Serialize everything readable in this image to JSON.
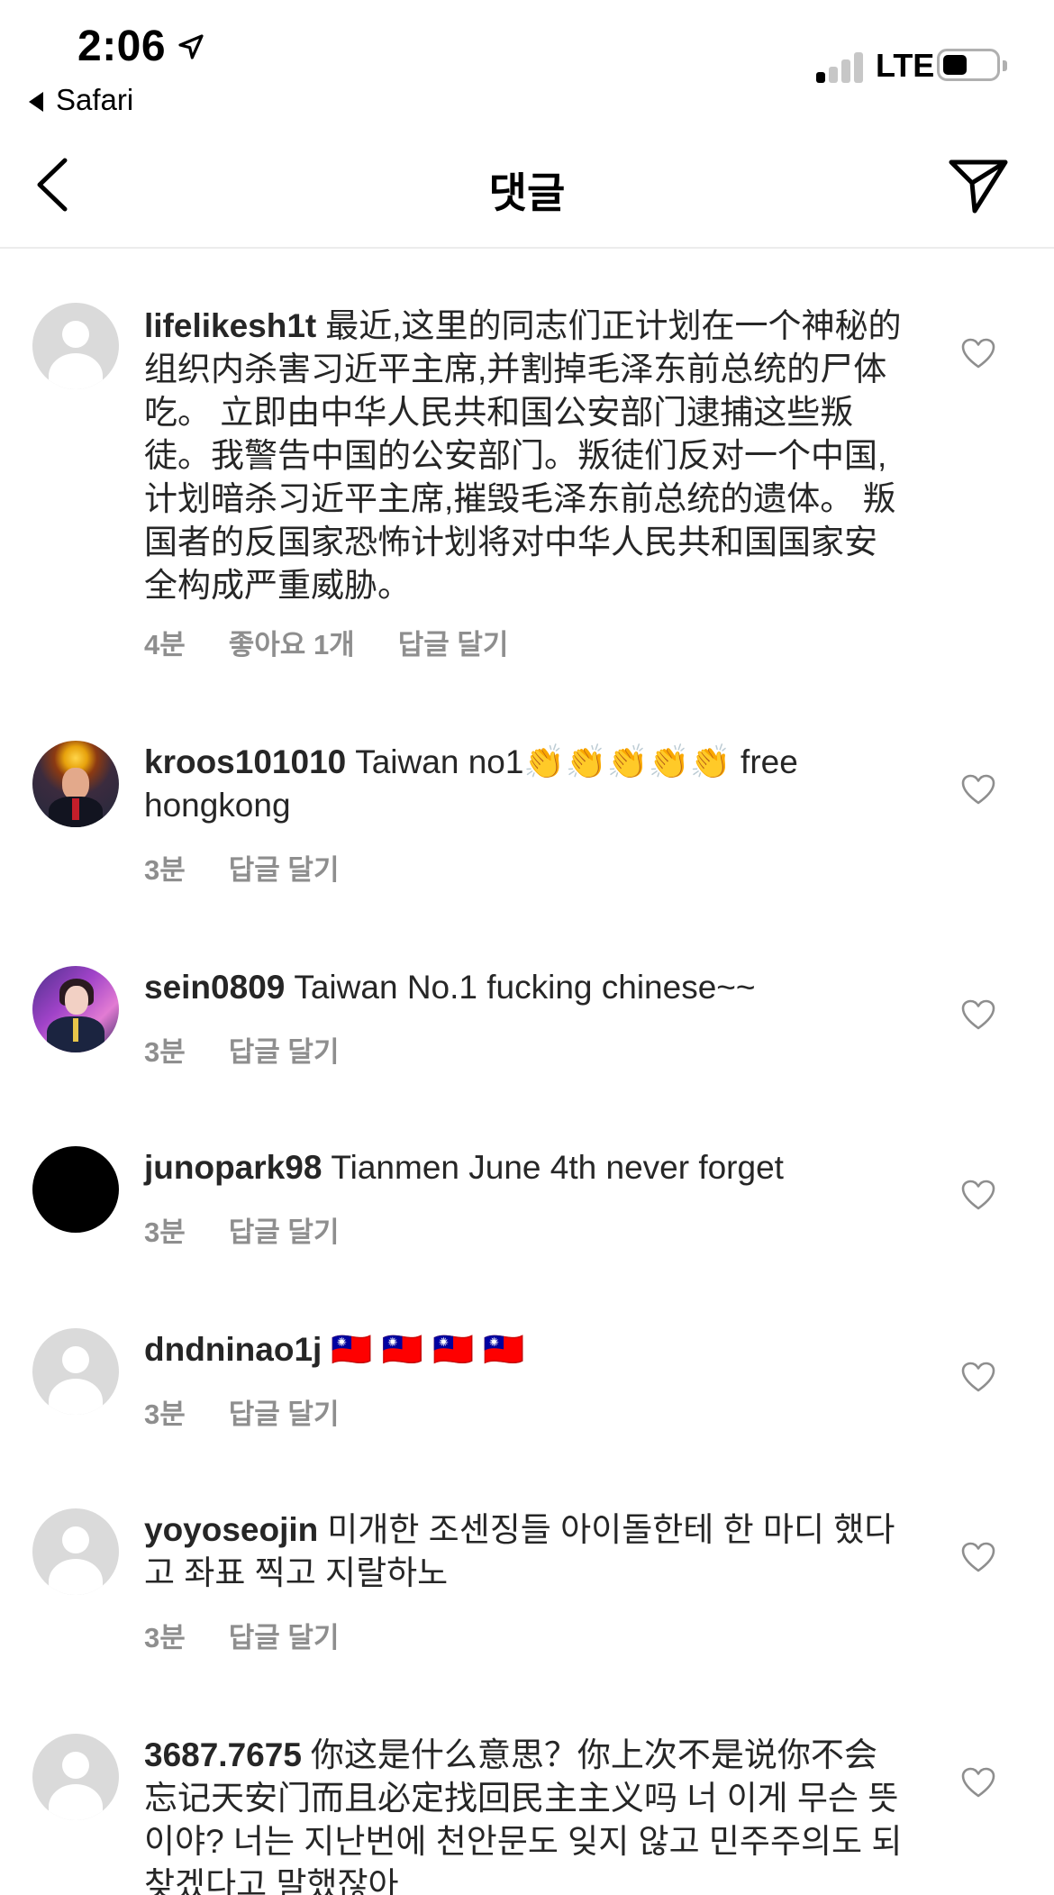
{
  "status_bar": {
    "time": "2:06",
    "back_app": "Safari",
    "network": "LTE"
  },
  "header": {
    "title": "댓글",
    "icons": {
      "back": "chevron-left-icon",
      "share": "paper-plane-icon"
    }
  },
  "labels": {
    "reply": "답글 달기"
  },
  "comments": [
    {
      "username": "lifelikesh1t",
      "text": "最近,这里的同志们正计划在一个神秘的组织内杀害习近平主席,并割掉毛泽东前总统的尸体吃。 立即由中华人民共和国公安部门逮捕这些叛徒。我警告中国的公安部门。叛徒们反对一个中国,计划暗杀习近平主席,摧毁毛泽东前总统的遗体。 叛国者的反国家恐怖计划将对中华人民共和国国家安全构成严重威胁。",
      "time": "4분",
      "likes": "좋아요 1개",
      "avatar": "default"
    },
    {
      "username": "kroos101010",
      "text": "Taiwan no1👏👏👏👏👏 free hongkong",
      "time": "3분",
      "avatar": "photo"
    },
    {
      "username": "sein0809",
      "text": "Taiwan No.1 fucking chinese~~",
      "time": "3분",
      "avatar": "photo"
    },
    {
      "username": "junopark98",
      "text": "Tianmen June 4th never forget",
      "time": "3분",
      "avatar": "black"
    },
    {
      "username": "dndninao1j",
      "text": "🇹🇼 🇹🇼 🇹🇼 🇹🇼",
      "time": "3분",
      "avatar": "default"
    },
    {
      "username": "yoyoseojin",
      "text": "미개한 조센징들 아이돌한테 한 마디 했다고 좌표 찍고 지랄하노",
      "time": "3분",
      "avatar": "default"
    },
    {
      "username": "3687.7675",
      "text": "你这是什么意思？你上次不是说你不会忘记天安门而且必定找回民主主义吗 너 이게 무슨 뜻이야? 너는 지난번에 천안문도 잊지 않고 민주주의도 되찾겠다고 말했잖아",
      "avatar": "default"
    }
  ]
}
